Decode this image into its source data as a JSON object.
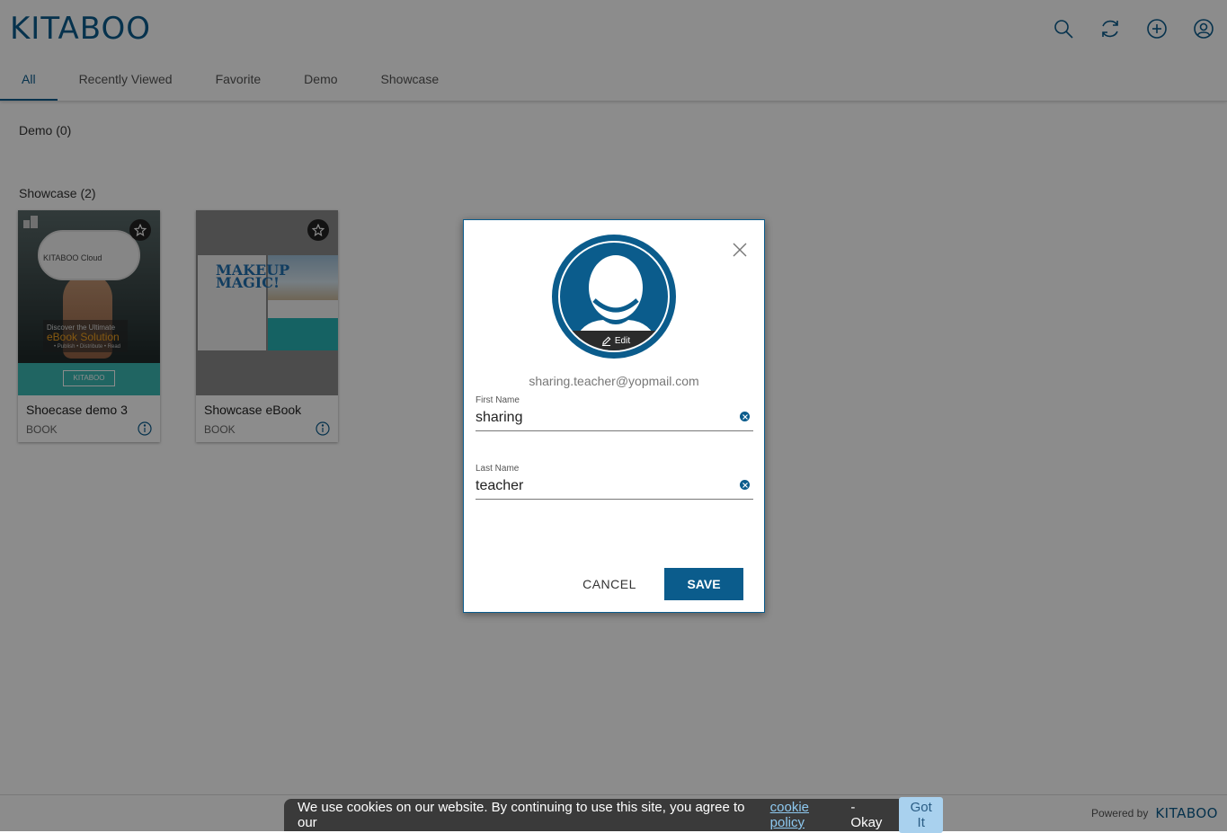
{
  "header": {
    "logo": "KITABOO",
    "icons": [
      "search-icon",
      "refresh-icon",
      "add-icon",
      "user-icon"
    ]
  },
  "tabs": [
    {
      "label": "All",
      "active": true
    },
    {
      "label": "Recently Viewed",
      "active": false
    },
    {
      "label": "Favorite",
      "active": false
    },
    {
      "label": "Demo",
      "active": false
    },
    {
      "label": "Showcase",
      "active": false
    }
  ],
  "sections": {
    "demo": "Demo (0)",
    "showcase": "Showcase (2)"
  },
  "books": [
    {
      "title": "Shoecase demo 3",
      "type": "BOOK",
      "cover": {
        "cloud_text": "KITABOO Cloud",
        "line1": "Discover the Ultimate",
        "line2": "eBook Solution",
        "line3": "• Publish • Distribute • Read",
        "badge": "KITABOO"
      }
    },
    {
      "title": "Showcase eBook",
      "type": "BOOK",
      "cover": {
        "headline": "MAKEUP MAGIC!"
      }
    }
  ],
  "modal": {
    "edit_label": "Edit",
    "email": "sharing.teacher@yopmail.com",
    "first_name_label": "First Name",
    "first_name_value": "sharing",
    "last_name_label": "Last Name",
    "last_name_value": "teacher",
    "cancel_label": "CANCEL",
    "save_label": "SAVE"
  },
  "cookie": {
    "text": "We use cookies on our website. By continuing to use this site, you agree to our",
    "link": "cookie policy",
    "suffix": "- Okay",
    "button": "Got It"
  },
  "footer": {
    "powered_by": "Powered by",
    "logo": "KITABOO"
  },
  "colors": {
    "brand": "#0b5c8c",
    "overlay": "rgba(0,0,0,.45)",
    "teal": "#3bb9b3"
  }
}
